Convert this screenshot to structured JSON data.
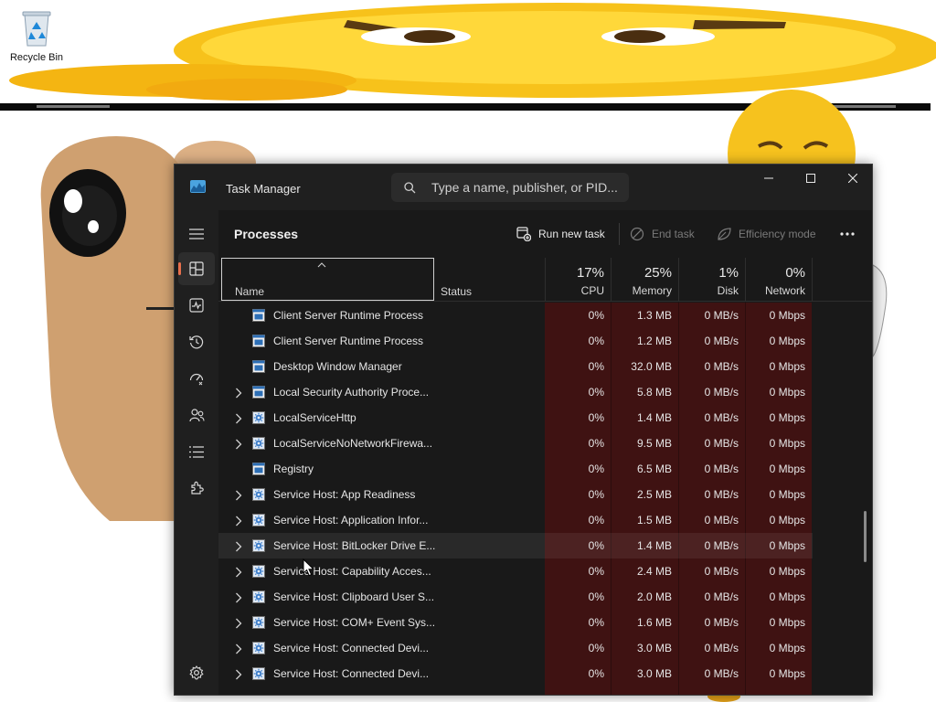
{
  "desktop": {
    "recycle_bin_label": "Recycle Bin"
  },
  "window": {
    "title": "Task Manager",
    "search_placeholder": "Type a name, publisher, or PID...",
    "controls": {
      "minimize": "minimize-icon",
      "maximize": "maximize-icon",
      "close": "close-icon"
    }
  },
  "nav": {
    "items": [
      "hamburger-icon",
      "processes-icon",
      "performance-icon",
      "app-history-icon",
      "startup-apps-icon",
      "users-icon",
      "details-icon",
      "services-icon",
      "settings-icon"
    ],
    "active": "processes"
  },
  "toolbar": {
    "page_title": "Processes",
    "run_new_task": "Run new task",
    "end_task": "End task",
    "efficiency_mode": "Efficiency mode",
    "more": "more-icon"
  },
  "columns": {
    "name": "Name",
    "status": "Status",
    "cpu": {
      "percent": "17%",
      "label": "CPU"
    },
    "memory": {
      "percent": "25%",
      "label": "Memory"
    },
    "disk": {
      "percent": "1%",
      "label": "Disk"
    },
    "network": {
      "percent": "0%",
      "label": "Network"
    }
  },
  "colors": {
    "window_bg": "#1f1f1f",
    "content_bg": "#191919",
    "heat_bg": "#3f1212",
    "accent": "#e8704d",
    "icon_blue": "#4aa3df"
  },
  "processes": [
    {
      "name": "Client Server Runtime Process",
      "icon": "window-app-icon",
      "expandable": false,
      "cpu": "0%",
      "memory": "1.3 MB",
      "disk": "0 MB/s",
      "network": "0 Mbps"
    },
    {
      "name": "Client Server Runtime Process",
      "icon": "window-app-icon",
      "expandable": false,
      "cpu": "0%",
      "memory": "1.2 MB",
      "disk": "0 MB/s",
      "network": "0 Mbps"
    },
    {
      "name": "Desktop Window Manager",
      "icon": "window-app-icon",
      "expandable": false,
      "cpu": "0%",
      "memory": "32.0 MB",
      "disk": "0 MB/s",
      "network": "0 Mbps"
    },
    {
      "name": "Local Security Authority Proce...",
      "icon": "window-app-icon",
      "expandable": true,
      "cpu": "0%",
      "memory": "5.8 MB",
      "disk": "0 MB/s",
      "network": "0 Mbps"
    },
    {
      "name": "LocalServiceHttp",
      "icon": "service-gear-icon",
      "expandable": true,
      "cpu": "0%",
      "memory": "1.4 MB",
      "disk": "0 MB/s",
      "network": "0 Mbps"
    },
    {
      "name": "LocalServiceNoNetworkFirewa...",
      "icon": "service-gear-icon",
      "expandable": true,
      "cpu": "0%",
      "memory": "9.5 MB",
      "disk": "0 MB/s",
      "network": "0 Mbps"
    },
    {
      "name": "Registry",
      "icon": "window-app-icon",
      "expandable": false,
      "cpu": "0%",
      "memory": "6.5 MB",
      "disk": "0 MB/s",
      "network": "0 Mbps"
    },
    {
      "name": "Service Host: App Readiness",
      "icon": "service-gear-icon",
      "expandable": true,
      "cpu": "0%",
      "memory": "2.5 MB",
      "disk": "0 MB/s",
      "network": "0 Mbps"
    },
    {
      "name": "Service Host: Application Infor...",
      "icon": "service-gear-icon",
      "expandable": true,
      "cpu": "0%",
      "memory": "1.5 MB",
      "disk": "0 MB/s",
      "network": "0 Mbps"
    },
    {
      "name": "Service Host: BitLocker Drive E...",
      "icon": "service-gear-icon",
      "expandable": true,
      "cpu": "0%",
      "memory": "1.4 MB",
      "disk": "0 MB/s",
      "network": "0 Mbps",
      "hovered": true
    },
    {
      "name": "Service Host: Capability Acces...",
      "icon": "service-gear-icon",
      "expandable": true,
      "cpu": "0%",
      "memory": "2.4 MB",
      "disk": "0 MB/s",
      "network": "0 Mbps"
    },
    {
      "name": "Service Host: Clipboard User S...",
      "icon": "service-gear-icon",
      "expandable": true,
      "cpu": "0%",
      "memory": "2.0 MB",
      "disk": "0 MB/s",
      "network": "0 Mbps"
    },
    {
      "name": "Service Host: COM+ Event Sys...",
      "icon": "service-gear-icon",
      "expandable": true,
      "cpu": "0%",
      "memory": "1.6 MB",
      "disk": "0 MB/s",
      "network": "0 Mbps"
    },
    {
      "name": "Service Host: Connected Devi...",
      "icon": "service-gear-icon",
      "expandable": true,
      "cpu": "0%",
      "memory": "3.0 MB",
      "disk": "0 MB/s",
      "network": "0 Mbps"
    },
    {
      "name": "Service Host: Connected Devi...",
      "icon": "service-gear-icon",
      "expandable": true,
      "cpu": "0%",
      "memory": "3.0 MB",
      "disk": "0 MB/s",
      "network": "0 Mbps"
    }
  ]
}
